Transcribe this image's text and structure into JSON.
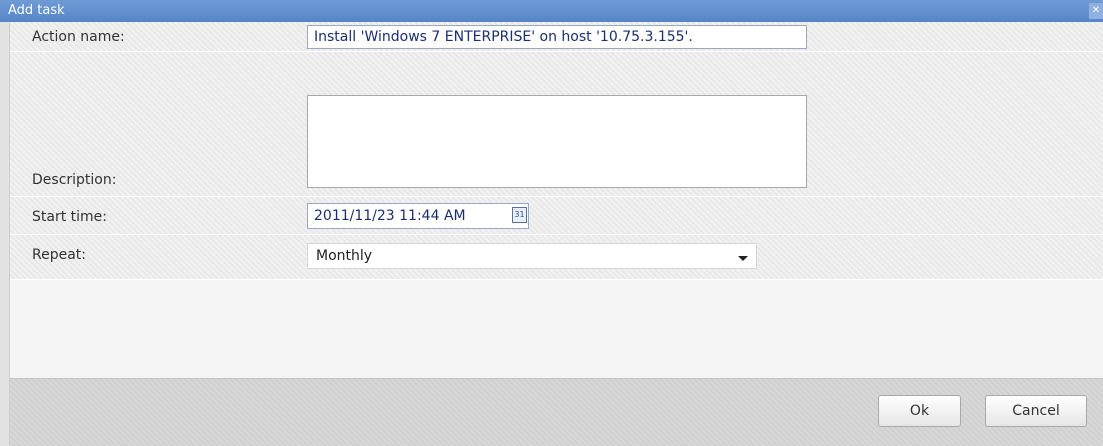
{
  "dialog": {
    "title": "Add task",
    "close_glyph": "✕"
  },
  "form": {
    "action_name": {
      "label": "Action name:",
      "value": "Install 'Windows 7 ENTERPRISE' on host '10.75.3.155'."
    },
    "description": {
      "label": "Description:",
      "value": ""
    },
    "start_time": {
      "label": "Start time:",
      "value": "2011/11/23 11:44 AM",
      "calendar_icon_text": "31"
    },
    "repeat": {
      "label": "Repeat:",
      "selected": "Monthly"
    }
  },
  "buttons": {
    "ok": "Ok",
    "cancel": "Cancel"
  }
}
